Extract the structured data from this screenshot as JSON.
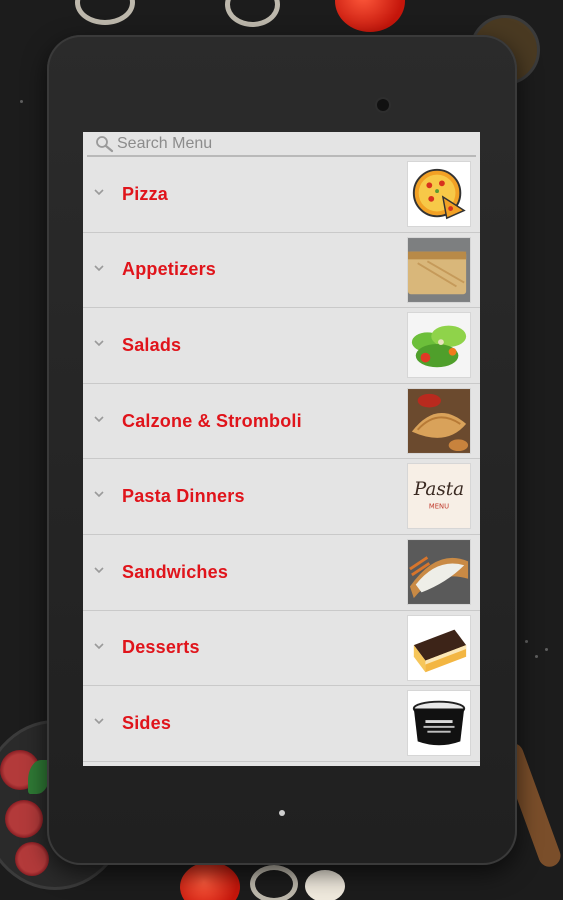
{
  "search": {
    "placeholder": "Search Menu"
  },
  "menu": {
    "items": [
      {
        "label": "Pizza",
        "icon": "pizza-icon"
      },
      {
        "label": "Appetizers",
        "icon": "appetizers-image"
      },
      {
        "label": "Salads",
        "icon": "salad-image"
      },
      {
        "label": "Calzone & Stromboli",
        "icon": "calzone-image"
      },
      {
        "label": "Pasta Dinners",
        "icon": "pasta-menu-logo"
      },
      {
        "label": "Sandwiches",
        "icon": "sandwich-image"
      },
      {
        "label": "Desserts",
        "icon": "dessert-cake-image"
      },
      {
        "label": "Sides",
        "icon": "sides-cup-image"
      }
    ]
  },
  "thumb_text": {
    "pasta_script": "Pasta",
    "pasta_sub": "MENU"
  },
  "colors": {
    "accent": "#e0141b",
    "list_background": "#e4e4e4",
    "tablet_frame": "#222222"
  }
}
